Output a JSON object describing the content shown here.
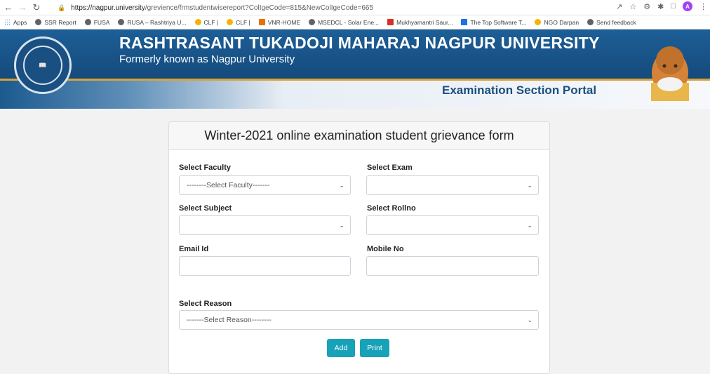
{
  "browser": {
    "url_host": "https://nagpur.university",
    "url_path": "/grevience/frmstudentwisereport?ColIgeCode=815&NewColIgeCode=665",
    "bookmarks": [
      "Apps",
      "SSR Report",
      "FUSA",
      "RUSA – Rashtriya U...",
      "CLF |",
      "CLF |",
      "VNR-HOME",
      "MSEDCL - Solar Ene...",
      "Mukhyamantri Saur...",
      "The Top Software T...",
      "NGO Darpan",
      "Send feedback"
    ],
    "profile_initial": "A"
  },
  "header": {
    "title": "RASHTRASANT TUKADOJI MAHARAJ NAGPUR UNIVERSITY",
    "subtitle": "Formerly known as Nagpur University",
    "portal": "Examination Section Portal"
  },
  "form": {
    "title": "Winter-2021 online examination student grievance form",
    "faculty": {
      "label": "Select Faculty",
      "value": "--------Select Faculty-------"
    },
    "exam": {
      "label": "Select Exam",
      "value": ""
    },
    "subject": {
      "label": "Select Subject",
      "value": ""
    },
    "rollno": {
      "label": "Select Rollno",
      "value": ""
    },
    "email": {
      "label": "Email Id",
      "value": ""
    },
    "mobile": {
      "label": "Mobile No",
      "value": ""
    },
    "reason": {
      "label": "Select Reason",
      "value": "-------Select Reason--------"
    },
    "add_label": "Add",
    "print_label": "Print"
  }
}
